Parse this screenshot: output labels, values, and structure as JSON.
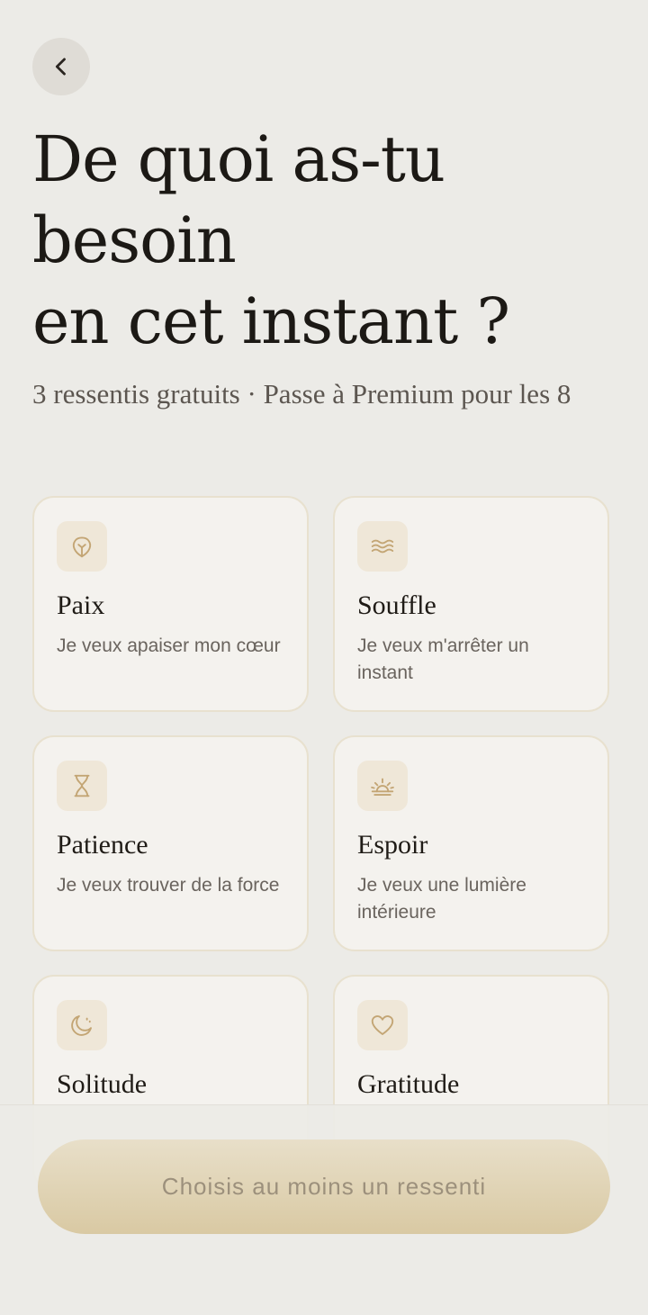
{
  "header": {
    "back_icon": "chevron-left-icon",
    "title_lines": [
      "De quoi as-tu",
      "besoin",
      "en cet instant ?"
    ],
    "subtitle": "3 ressentis gratuits · Passe à Premium pour les 8"
  },
  "feelings": [
    {
      "title": "Paix",
      "description": "Je veux apaiser mon cœur",
      "icon": "leaf-icon"
    },
    {
      "title": "Souffle",
      "description": "Je veux m'arrêter un instant",
      "icon": "waves-icon"
    },
    {
      "title": "Patience",
      "description": "Je veux trouver de la force",
      "icon": "hourglass-icon"
    },
    {
      "title": "Espoir",
      "description": "Je veux une lumière intérieure",
      "icon": "sunrise-icon"
    },
    {
      "title": "Solitude",
      "description": "",
      "icon": "moon-icon"
    },
    {
      "title": "Gratitude",
      "description": "",
      "icon": "heart-icon"
    }
  ],
  "footer": {
    "cta_label": "Choisis au moins un ressenti"
  },
  "colors": {
    "background": "#ecebe7",
    "card": "#f4f2ee",
    "icon_bg": "#efe7d8",
    "accent_gold": "#c3a574",
    "cta_gradient_top": "#e8dfc9",
    "cta_gradient_bottom": "#d9c9a3"
  }
}
